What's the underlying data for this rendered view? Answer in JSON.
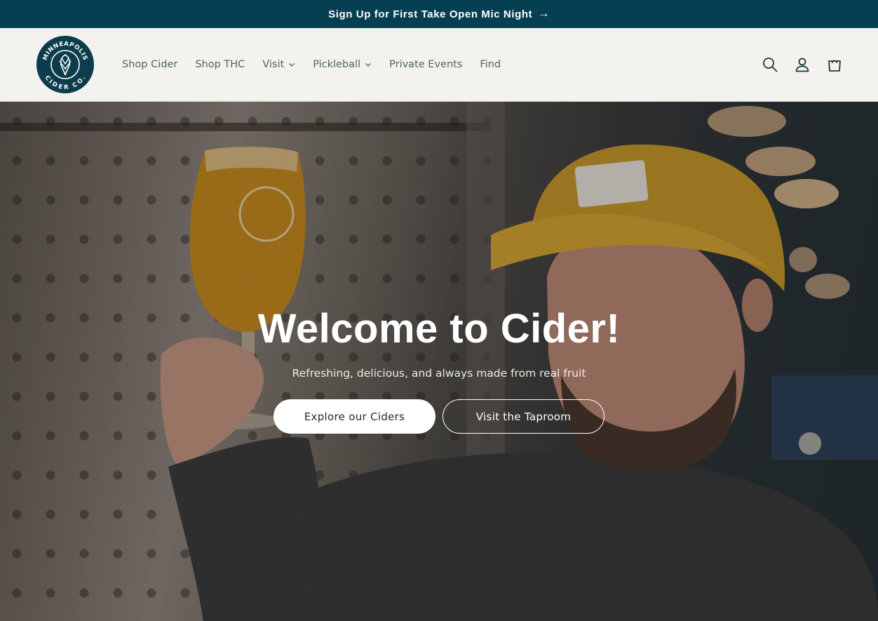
{
  "announcement": {
    "text": "Sign Up for First Take Open Mic Night",
    "arrow": "→"
  },
  "logo": {
    "name": "Minneapolis Cider Co.",
    "top_text": "MINNEAPOLIS",
    "bottom_text": "CIDER CO.",
    "color": "#0c3d4c"
  },
  "nav": {
    "items": [
      {
        "label": "Shop Cider",
        "has_dropdown": false
      },
      {
        "label": "Shop THC",
        "has_dropdown": false
      },
      {
        "label": "Visit",
        "has_dropdown": true
      },
      {
        "label": "Pickleball",
        "has_dropdown": true
      },
      {
        "label": "Private Events",
        "has_dropdown": false
      },
      {
        "label": "Find",
        "has_dropdown": false
      }
    ]
  },
  "header_icons": [
    "search-icon",
    "account-icon",
    "cart-icon"
  ],
  "hero": {
    "title": "Welcome to Cider!",
    "subtitle": "Refreshing, delicious, and always made from real fruit",
    "primary_button": "Explore our Ciders",
    "secondary_button": "Visit the Taproom"
  },
  "colors": {
    "brand_dark": "#063f52",
    "header_bg": "#f3f2ee",
    "nav_text": "#4f6468"
  }
}
